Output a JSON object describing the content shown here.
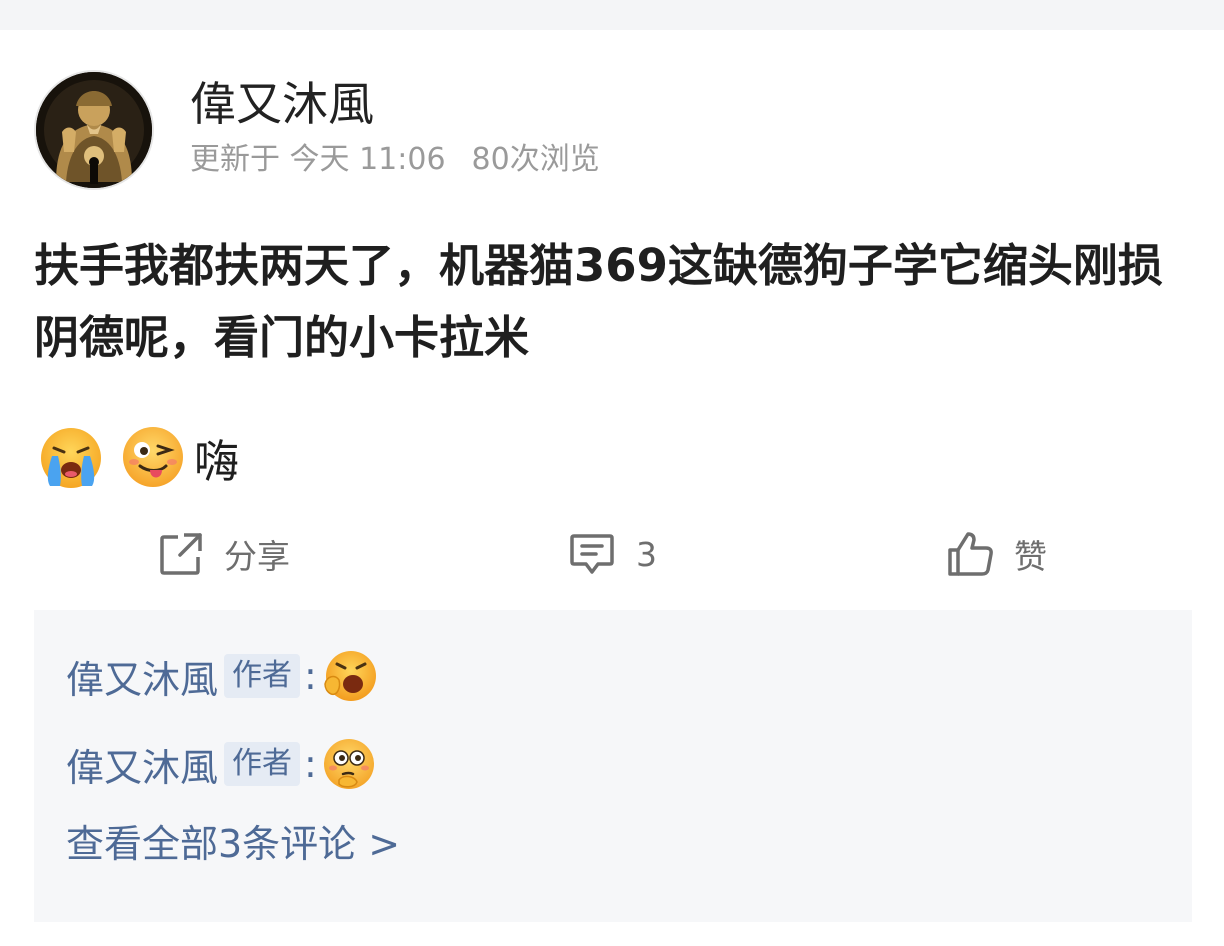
{
  "post": {
    "author": "偉又沐風",
    "updated": "更新于 今天 11:06",
    "views": "80次浏览",
    "title": "扶手我都扶两天了，机器猫369这缺德狗子学它缩头刚损阴德呢，看门的小卡拉米",
    "emojis": [
      "crying-face-emoji",
      "winking-tongue-face-emoji"
    ],
    "emoji_text": "嗨"
  },
  "actions": {
    "share_label": "分享",
    "comment_count": "3",
    "like_label": "赞"
  },
  "comments": {
    "items": [
      {
        "author": "偉又沐風",
        "badge": "作者",
        "separator": ":",
        "emoji": "yawning-face-emoji"
      },
      {
        "author": "偉又沐風",
        "badge": "作者",
        "separator": ":",
        "emoji": "thinking-wide-eyed-face-emoji"
      }
    ],
    "view_all": "查看全部3条评论 >"
  },
  "colors": {
    "link_blue": "#4e6a96",
    "badge_bg": "#e5ebf4",
    "muted_gray": "#9a9a9a",
    "comments_bg": "#f6f7f9"
  }
}
